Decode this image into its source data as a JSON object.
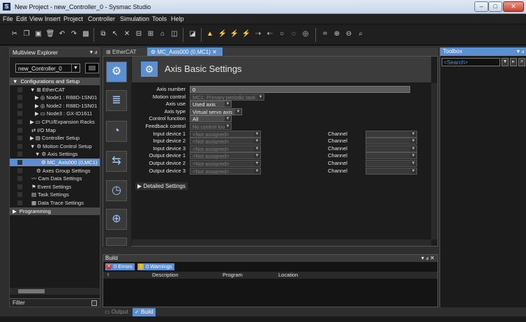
{
  "window": {
    "title": "New Project - new_Controller_0 - Sysmac Studio",
    "app_icon_glyph": "S"
  },
  "window_buttons": {
    "minimize": "–",
    "maximize": "□",
    "close": "✕"
  },
  "menu": [
    "File",
    "Edit",
    "View",
    "Insert",
    "Project",
    "Controller",
    "Simulation",
    "Tools",
    "Help"
  ],
  "toolbar_icons": [
    "cut-icon",
    "copy-icon",
    "paste-icon",
    "delete-icon",
    "undo-icon",
    "redo-icon",
    "build-icon",
    "online-icon",
    "offline-icon",
    "synchronize-icon",
    "transfer-icon",
    "transfer-from-icon",
    "compare-icon",
    "run-icon",
    "stop-icon",
    "reset-icon",
    "warning-icon",
    "force-on-icon",
    "force-off-icon",
    "force-cancel-icon",
    "set-icon",
    "reset-bit-icon",
    "simulation-run-icon",
    "simulation-pause-icon",
    "simulation-stop-icon",
    "zoom-fit-icon",
    "zoom-in-icon",
    "zoom-out-icon",
    "cross-reference-icon"
  ],
  "explorer": {
    "title": "Multiview Explorer",
    "pin": "▾ ⅎ",
    "controller": "new_Controller_0",
    "items": [
      {
        "label": "Configurations and Setup",
        "indent": 0,
        "arrow": "▼",
        "kind": "section"
      },
      {
        "label": "EtherCAT",
        "indent": 1,
        "arrow": "▼",
        "icon": "⊞"
      },
      {
        "label": "Node1 : R88D-1SN01",
        "indent": 2,
        "arrow": "▶",
        "icon": "◎"
      },
      {
        "label": "Node2 : R88D-1SN01",
        "indent": 2,
        "arrow": "▶",
        "icon": "◎"
      },
      {
        "label": "Node3 : GX-ID1611",
        "indent": 2,
        "arrow": "▶",
        "icon": "▭"
      },
      {
        "label": "CPU/Expansion Racks",
        "indent": 1,
        "arrow": "▶",
        "icon": "▭"
      },
      {
        "label": "I/O Map",
        "indent": 1,
        "arrow": "",
        "icon": "⇄"
      },
      {
        "label": "Controller Setup",
        "indent": 1,
        "arrow": "▶",
        "icon": "▤"
      },
      {
        "label": "Motion Control Setup",
        "indent": 1,
        "arrow": "▼",
        "icon": "⚙"
      },
      {
        "label": "Axis Settings",
        "indent": 2,
        "arrow": "▼",
        "icon": "⚙"
      },
      {
        "label": "MC_Axis000 (0,MC1)",
        "indent": 3,
        "arrow": "",
        "icon": "⚙",
        "kind": "sel"
      },
      {
        "label": "Axes Group Settings",
        "indent": 2,
        "arrow": "",
        "icon": "⚙"
      },
      {
        "label": "Cam Data Settings",
        "indent": 1,
        "arrow": "",
        "icon": "〰"
      },
      {
        "label": "Event Settings",
        "indent": 1,
        "arrow": "",
        "icon": "⚑"
      },
      {
        "label": "Task Settings",
        "indent": 1,
        "arrow": "",
        "icon": "▤"
      },
      {
        "label": "Data Trace Settings",
        "indent": 1,
        "arrow": "",
        "icon": "▦"
      },
      {
        "label": "Programming",
        "indent": 0,
        "arrow": "▶",
        "kind": "section"
      }
    ],
    "filter": "Filter"
  },
  "doc_tabs": [
    {
      "label": "EtherCAT",
      "icon": "⊞",
      "active": false
    },
    {
      "label": "MC_Axis000 (0,MC1)",
      "icon": "⚙",
      "active": true,
      "close": "✕"
    }
  ],
  "panel": {
    "title": "Axis Basic Settings",
    "side_icons": [
      "axis-basic-settings-icon",
      "unit-conversion-icon",
      "operation-settings-icon",
      "other-operation-settings-icon",
      "limit-settings-icon",
      "position-count-settings-icon",
      "servo-drive-settings-icon"
    ],
    "fields": [
      {
        "label": "Axis number",
        "value": "0",
        "style": "input",
        "width": 0
      },
      {
        "label": "Motion control",
        "value": "MC1: Primary periodic task",
        "style": "dis",
        "width": 1
      },
      {
        "label": "Axis use",
        "value": "Used axis",
        "style": "dd",
        "width": 2
      },
      {
        "label": "Axis type",
        "value": "Virtual servo axis",
        "style": "dd",
        "width": 3
      },
      {
        "label": "Control function",
        "value": "All",
        "style": "dd",
        "width": 2
      },
      {
        "label": "Feedback control",
        "value": "No control loop",
        "style": "dis",
        "width": 2
      },
      {
        "label": "Input device 1",
        "value": "<Not assigned>",
        "style": "dis",
        "width": 4,
        "channel": true
      },
      {
        "label": "Input device 2",
        "value": "<Not assigned>",
        "style": "dis",
        "width": 4,
        "channel": true
      },
      {
        "label": "Input device 3",
        "value": "<Not assigned>",
        "style": "dis",
        "width": 4,
        "channel": true
      },
      {
        "label": "Output device 1",
        "value": "<Not assigned>",
        "style": "dis",
        "width": 4,
        "channel": true
      },
      {
        "label": "Output device 2",
        "value": "<Not assigned>",
        "style": "dis",
        "width": 4,
        "channel": true
      },
      {
        "label": "Output device 3",
        "value": "<Not assigned>",
        "style": "dis",
        "width": 4,
        "channel": true
      }
    ],
    "channel_label": "Channel",
    "detailed": "▶ Detailed Settings"
  },
  "build": {
    "title": "Build",
    "controls": "▾ ⅎ ✕",
    "errors": "0 Errors",
    "warnings": "0 Warnings",
    "columns": [
      "!",
      "Description",
      "Program",
      "Location"
    ],
    "tabs": [
      {
        "label": "Output",
        "active": false
      },
      {
        "label": "Build",
        "active": true
      }
    ]
  },
  "toolbox": {
    "title": "Toolbox",
    "pin": "▾ ⅎ",
    "search_placeholder": "<Search>"
  },
  "colors": {
    "accent": "#5b8fd0",
    "warning": "#ffd02a",
    "error": "#d9342b"
  }
}
